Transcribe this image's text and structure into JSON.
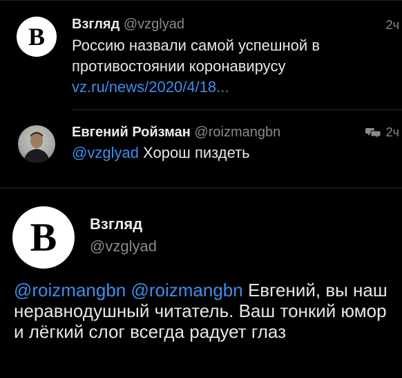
{
  "tweets": [
    {
      "name": "Взгляд",
      "handle": "@vzglyad",
      "time": "2ч",
      "avatar_letter": "B",
      "text_plain": "Россию назвали самой успешной в противостоянии коронавирусу ",
      "link": "vz.ru/news/2020/4/18..."
    },
    {
      "name": "Евгений Ройзман",
      "handle": "@roizmangbn",
      "time": "2ч",
      "mention": "@vzglyad",
      "text_rest": " Хорош пиздеть"
    }
  ],
  "main_tweet": {
    "name": "Взгляд",
    "handle": "@vzglyad",
    "avatar_letter": "B",
    "mention_1": "@roizmangbn",
    "mention_2": "@roizmangbn",
    "text_rest": " Евгений, вы наш неравнодушный читатель. Ваш тонкий юмор и лёгкий слог всегда радует глаз"
  },
  "icons": {
    "reply_indicator": "conversation-icon"
  },
  "colors": {
    "background": "#000000",
    "link": "#3d8ef0",
    "secondary_text": "#8a8a8e"
  }
}
